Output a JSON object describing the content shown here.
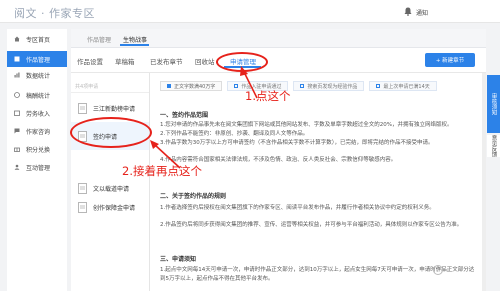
{
  "header": {
    "logo": "阅文 · 作家专区",
    "notify": "通知"
  },
  "sidebar": {
    "items": [
      {
        "label": "专区首页",
        "icon": "home-icon"
      },
      {
        "label": "作品管理",
        "icon": "book-icon",
        "active": true
      },
      {
        "label": "数据统计",
        "icon": "chart-icon"
      },
      {
        "label": "稿酬统计",
        "icon": "coin-icon"
      },
      {
        "label": "劳务收入",
        "icon": "wallet-icon"
      },
      {
        "label": "作家咨询",
        "icon": "chat-icon"
      },
      {
        "label": "积分兑换",
        "icon": "gift-icon"
      },
      {
        "label": "互动管理",
        "icon": "users-icon"
      }
    ]
  },
  "breadcrumb": {
    "items": [
      "作品管理",
      "生物战事"
    ]
  },
  "tabs": {
    "items": [
      "作品设置",
      "草稿箱",
      "已发布章节",
      "回收站",
      "申请管理"
    ],
    "new_button": "+ 新建章节"
  },
  "apply_list": {
    "search_placeholder": "共4项申请",
    "items": [
      "三江新勤榜申请",
      "签约申请",
      "文以载道申请",
      "创作保障金申请"
    ]
  },
  "chips": [
    "正文字数满40万字",
    "作品入驻申请通过",
    "搜索页发现为经验作品",
    "最上次申请已满14天"
  ],
  "doc": {
    "s1_title": "一、签约作品范围",
    "s1_p1": "1.您对申请的作品事先未在阅文集团旗下网站或其他网站发布、字数及单章字数超过全文的20%，并拥有独立网络版权。",
    "s1_p2": "2.下列作品不能签约：非原创、抄袭、翻译及同人文等作品。",
    "s1_p3": "3.作品字数为30万字以上方可申请签约（不含作品相关字数不计算字数），已完结，即将完结的作品不接受申请。",
    "s1_p4": "4.作品内容需符合国家相关法律法规，不涉及色情、政治、反人类反社会、宗教信仰等敏感内容。",
    "s2_title": "二、关于签约作品的规则",
    "s2_p1": "1.作者选择签约后授权在阅文集团旗下的作家专区、阅读平台发布作品，并履行作者相关协议中约定的权利义务。",
    "s2_p2": "2.作品签约后将同步获得阅文集团的推荐、宣传、运营等相关权益，并可参与平台福利活动，具体规则以作家专区公告为准。",
    "s3_title": "三、申请须知",
    "s3_p1": "1.起点中文网每14天可申请一次，申请时作品正文部分，达到10万字以上，起点女生网每7天可申请一次，申请时作品正文部分达到5万字以上，起点作品不得在其他平台发布。"
  },
  "annotations": {
    "step1": "1.点这个",
    "step2": "2.接着再点这个"
  },
  "right_tabs": [
    "审核须知",
    "意见反馈"
  ]
}
